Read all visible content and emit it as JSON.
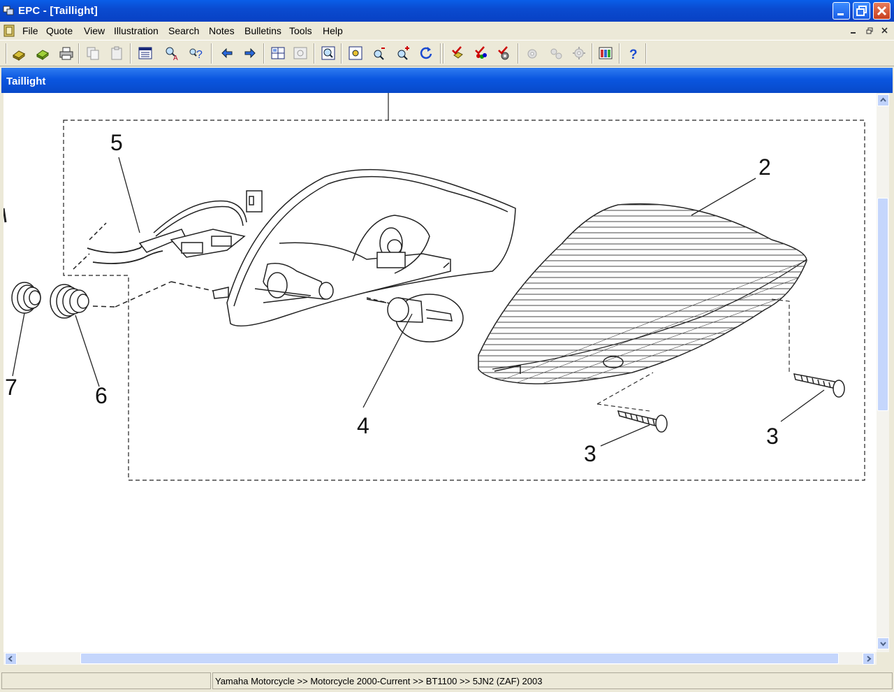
{
  "window": {
    "title": "EPC - [Taillight]"
  },
  "menu": {
    "items": [
      "File",
      "Quote",
      "View",
      "Illustration",
      "Search",
      "Notes",
      "Bulletins",
      "Tools",
      "Help"
    ]
  },
  "document": {
    "title": "Taillight"
  },
  "diagram": {
    "callouts": [
      "5",
      "2",
      "7",
      "6",
      "4",
      "3",
      "3"
    ]
  },
  "status": {
    "breadcrumb": "Yamaha Motorcycle >> Motorcycle 2000-Current >> BT1100 >> 5JN2 (ZAF) 2003"
  },
  "icons": {
    "app": "epc-app-icon",
    "toolbar": [
      "open-book-icon",
      "book-icon",
      "print-icon",
      "copy-icon",
      "paste-icon",
      "window-icon",
      "find-text-icon",
      "help-query-icon",
      "back-arrow-icon",
      "forward-arrow-icon",
      "grid-view-icon",
      "thumbnail-icon",
      "zoom-window-icon",
      "fit-icon",
      "zoom-out-icon",
      "zoom-in-icon",
      "refresh-icon",
      "check-icon",
      "color-check-icon",
      "settings-check-icon",
      "gear-disabled-icon",
      "gears-disabled-icon",
      "gear-group-disabled-icon",
      "catalog-icon",
      "help-icon"
    ]
  },
  "colors": {
    "title_bar": "#0a4bd0",
    "doc_caption": "#0a56e0",
    "chrome": "#ece9d8"
  }
}
